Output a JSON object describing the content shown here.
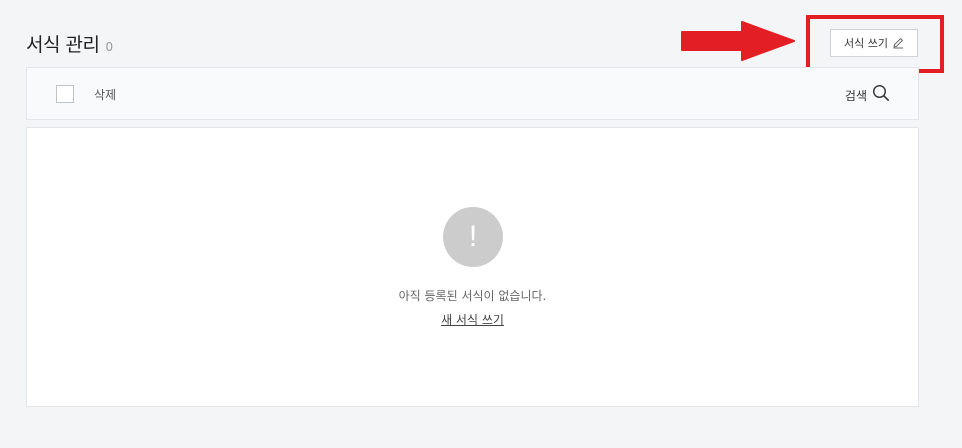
{
  "header": {
    "title": "서식 관리",
    "count": "0"
  },
  "actions": {
    "write_label": "서식 쓰기",
    "write_icon": "pencil-icon"
  },
  "toolbar": {
    "delete_label": "삭제",
    "search_label": "검색",
    "search_icon": "search-icon"
  },
  "empty_state": {
    "icon_symbol": "!",
    "message": "아직 등록된 서식이 없습니다.",
    "link_label": "새 서식 쓰기"
  },
  "annotation": {
    "arrow_color": "#e31e24",
    "highlight_color": "#e31e24"
  }
}
